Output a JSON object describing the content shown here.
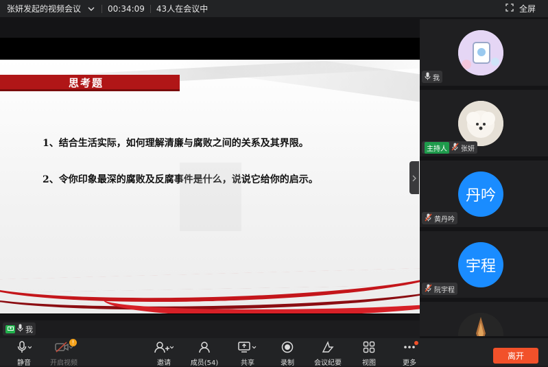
{
  "topbar": {
    "meeting_title": "张妍发起的视频会议",
    "duration": "00:34:09",
    "participants_in_meeting": "43人在会议中",
    "fullscreen_label": "全屏"
  },
  "slide": {
    "heading": "思考题",
    "question1": "1、结合生活实际，如何理解清廉与腐败之间的关系及其界限。",
    "question2": "2、令你印象最深的腐败及反腐事件是什么，说说它给你的启示。"
  },
  "self_view": {
    "name": "我"
  },
  "participants": [
    {
      "name": "我",
      "avatar_text": "",
      "muted": false,
      "host": false,
      "avatar_type": "cartoon"
    },
    {
      "name": "张妍",
      "avatar_text": "",
      "muted": true,
      "host": true,
      "host_label": "主持人",
      "avatar_type": "dog"
    },
    {
      "name": "黄丹吟",
      "avatar_text": "丹吟",
      "muted": true,
      "host": false,
      "avatar_type": "initials"
    },
    {
      "name": "阮宇程",
      "avatar_text": "宇程",
      "muted": true,
      "host": false,
      "avatar_type": "initials"
    },
    {
      "name": "",
      "avatar_text": "",
      "muted": false,
      "host": false,
      "avatar_type": "dark"
    }
  ],
  "toolbar": {
    "mute": "静音",
    "camera": "开启视频",
    "camera_badge": "!",
    "invite": "邀请",
    "members": "成员(54)",
    "share": "共享",
    "record": "录制",
    "minutes": "会议纪要",
    "view": "视图",
    "more": "更多",
    "leave": "离开"
  },
  "colors": {
    "leave_button": "#f2512a",
    "avatar_blue": "#1a8cff",
    "slide_red": "#b01617",
    "host_green": "#1f9b4c"
  }
}
